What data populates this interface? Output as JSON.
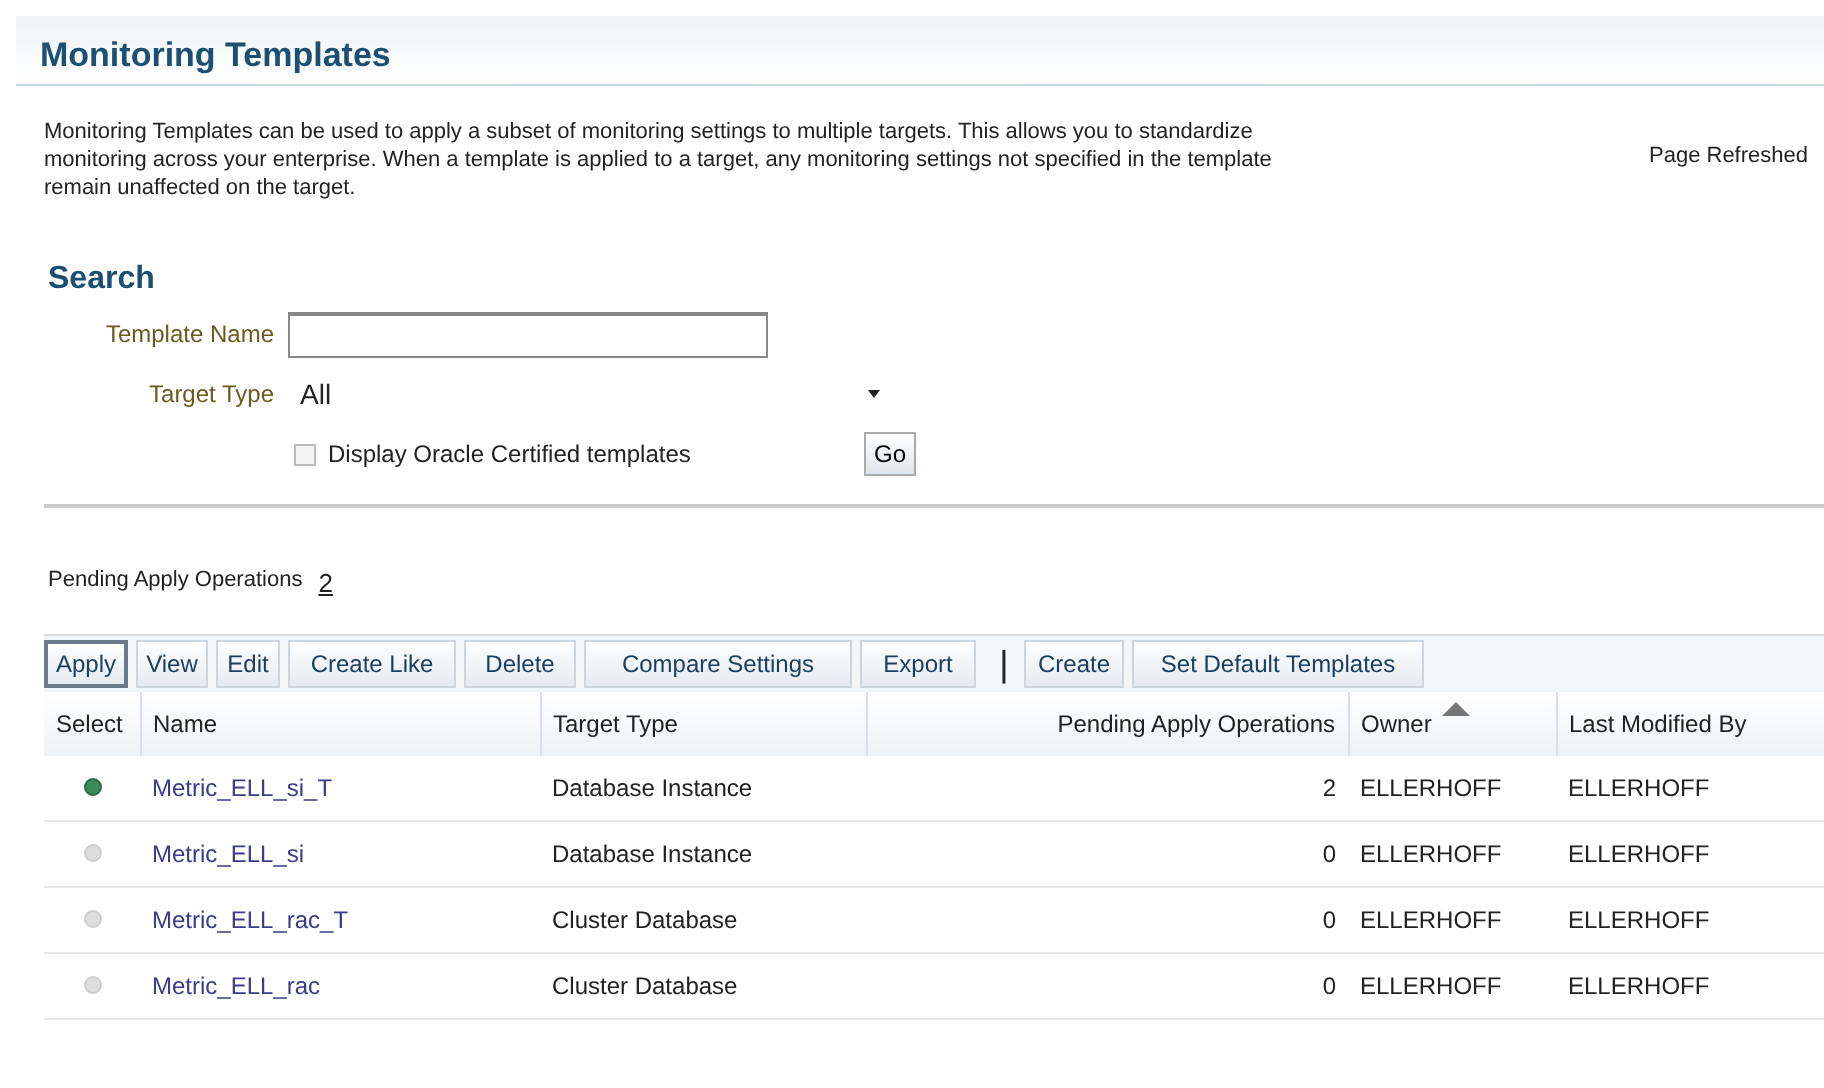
{
  "page_title": "Monitoring Templates",
  "description": "Monitoring Templates can be used to apply a subset of monitoring settings to multiple targets. This allows you to standardize monitoring across your enterprise. When a template is applied to a target, any monitoring settings not specified in the template remain unaffected on the target.",
  "page_refreshed": "Page Refreshed",
  "search": {
    "title": "Search",
    "template_name_label": "Template Name",
    "target_type_label": "Target Type",
    "target_type_value": "All",
    "certified_label": "Display Oracle Certified templates",
    "certified_checked": false,
    "go": "Go"
  },
  "pending": {
    "label": "Pending Apply Operations",
    "count": "2"
  },
  "toolbar": [
    {
      "label": "Apply",
      "kind": "button"
    },
    {
      "label": "View",
      "kind": "button"
    },
    {
      "label": "Edit",
      "kind": "button"
    },
    {
      "label": "Create Like",
      "kind": "button"
    },
    {
      "label": "Delete",
      "kind": "button"
    },
    {
      "label": "Compare Settings",
      "kind": "button"
    },
    {
      "label": "Export",
      "kind": "button"
    },
    {
      "label": "|",
      "kind": "separator"
    },
    {
      "label": "Create",
      "kind": "button"
    },
    {
      "label": "Set Default Templates",
      "kind": "button"
    }
  ],
  "table": {
    "columns": [
      {
        "label": "Select",
        "sorted": false
      },
      {
        "label": "Name",
        "sorted": false
      },
      {
        "label": "Target Type",
        "sorted": false
      },
      {
        "label": "Pending Apply Operations",
        "sorted": false
      },
      {
        "label": "Owner",
        "sorted": true
      },
      {
        "label": "Last Modified By",
        "sorted": false
      }
    ],
    "rows": [
      {
        "selected": true,
        "name": "Metric_ELL_si_T",
        "target_type": "Database Instance",
        "pending": "2",
        "owner": "ELLERHOFF",
        "modified_by": "ELLERHOFF"
      },
      {
        "selected": false,
        "name": "Metric_ELL_si",
        "target_type": "Database Instance",
        "pending": "0",
        "owner": "ELLERHOFF",
        "modified_by": "ELLERHOFF"
      },
      {
        "selected": false,
        "name": "Metric_ELL_rac_T",
        "target_type": "Cluster Database",
        "pending": "0",
        "owner": "ELLERHOFF",
        "modified_by": "ELLERHOFF"
      },
      {
        "selected": false,
        "name": "Metric_ELL_rac",
        "target_type": "Cluster Database",
        "pending": "0",
        "owner": "ELLERHOFF",
        "modified_by": "ELLERHOFF"
      }
    ]
  }
}
